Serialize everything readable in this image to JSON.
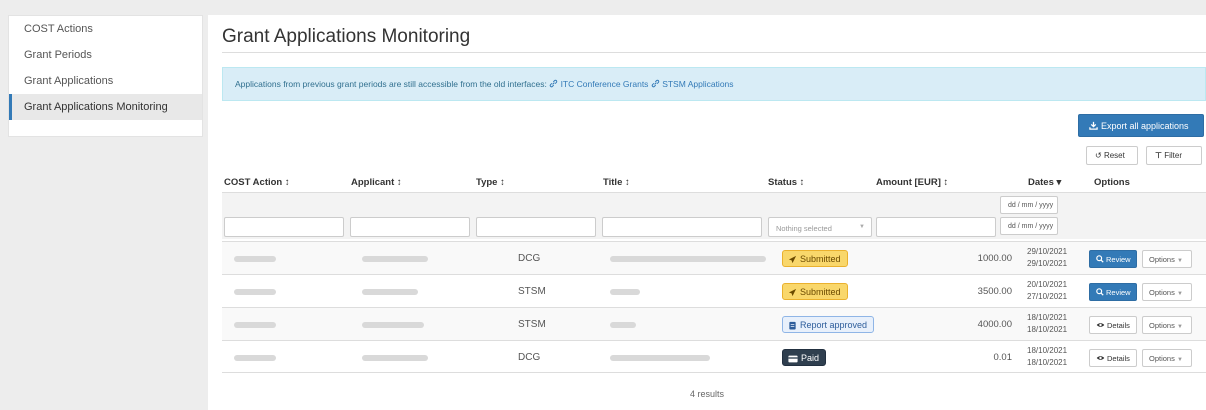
{
  "sidebar": {
    "items": [
      {
        "label": "COST Actions"
      },
      {
        "label": "Grant Periods"
      },
      {
        "label": "Grant Applications"
      },
      {
        "label": "Grant Applications Monitoring"
      }
    ]
  },
  "page": {
    "title": "Grant Applications Monitoring"
  },
  "alert": {
    "text": "Applications from previous grant periods are still accessible from the old interfaces: ",
    "link1": "ITC Conference Grants",
    "link2": "STSM Applications"
  },
  "toolbar": {
    "export_label": "Export all applications",
    "reset_label": "Reset",
    "filter_label": "Filter"
  },
  "table": {
    "headers": {
      "action": "COST Action ↕",
      "applicant": "Applicant ↕",
      "type": "Type ↕",
      "title": "Title ↕",
      "status": "Status ↕",
      "amount": "Amount [EUR] ↕",
      "dates": "Dates ▾",
      "options": "Options"
    },
    "filters": {
      "status_placeholder": "Nothing selected",
      "date_from_placeholder": "dd / mm / yyyy",
      "date_to_placeholder": "dd / mm / yyyy"
    },
    "rows": [
      {
        "type": "DCG",
        "status": "Submitted",
        "amount": "1000.00",
        "date1": "29/10/2021",
        "date2": "29/10/2021",
        "action": "Review",
        "options": "Options"
      },
      {
        "type": "STSM",
        "status": "Submitted",
        "amount": "3500.00",
        "date1": "20/10/2021",
        "date2": "27/10/2021",
        "action": "Review",
        "options": "Options"
      },
      {
        "type": "STSM",
        "status": "Report approved",
        "amount": "4000.00",
        "date1": "18/10/2021",
        "date2": "18/10/2021",
        "action": "Details",
        "options": "Options"
      },
      {
        "type": "DCG",
        "status": "Paid",
        "amount": "0.01",
        "date1": "18/10/2021",
        "date2": "18/10/2021",
        "action": "Details",
        "options": "Options"
      }
    ],
    "results": "4 results"
  },
  "colors": {
    "primary": "#337ab7",
    "alert_bg": "#d9edf7",
    "submitted": "#f9d76b",
    "paid": "#2f3f4f"
  }
}
